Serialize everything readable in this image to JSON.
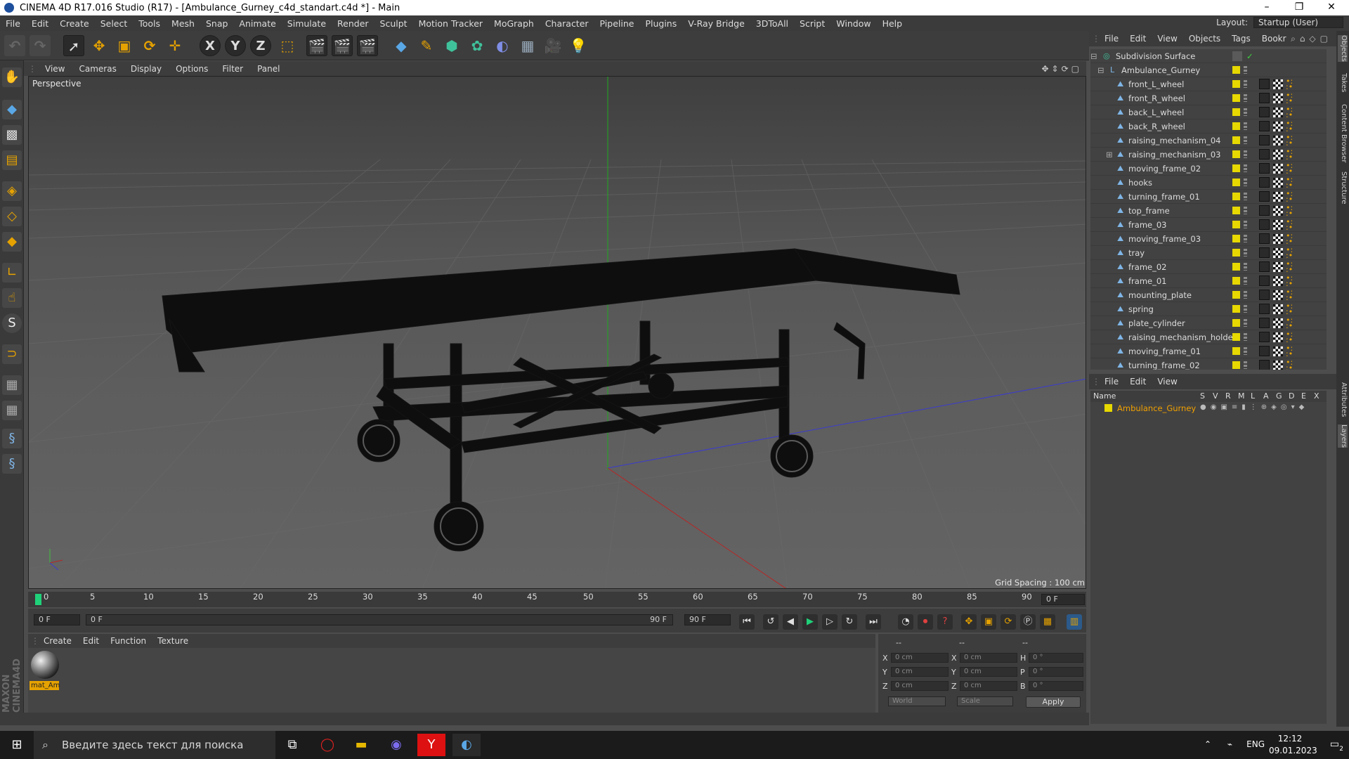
{
  "titlebar": {
    "title": "CINEMA 4D R17.016 Studio (R17) - [Ambulance_Gurney_c4d_standart.c4d *] - Main",
    "minimize": "–",
    "restore": "❐",
    "close": "✕"
  },
  "menu": [
    "File",
    "Edit",
    "Create",
    "Select",
    "Tools",
    "Mesh",
    "Snap",
    "Animate",
    "Simulate",
    "Render",
    "Sculpt",
    "Motion Tracker",
    "MoGraph",
    "Character",
    "Pipeline",
    "Plugins",
    "V-Ray Bridge",
    "3DToAll",
    "Script",
    "Window",
    "Help"
  ],
  "layout": {
    "label": "Layout:",
    "value": "Startup (User)"
  },
  "viewport": {
    "menu": [
      "View",
      "Cameras",
      "Display",
      "Options",
      "Filter",
      "Panel"
    ],
    "label": "Perspective",
    "grid_spacing": "Grid Spacing : 100 cm"
  },
  "timeline": {
    "ticks": [
      "0",
      "5",
      "10",
      "15",
      "20",
      "25",
      "30",
      "35",
      "40",
      "45",
      "50",
      "55",
      "60",
      "65",
      "70",
      "75",
      "80",
      "85",
      "90"
    ],
    "current_frame_right": "0 F",
    "start": "0 F",
    "range_start": "0 F",
    "range_end": "90 F",
    "end": "90 F"
  },
  "material": {
    "menu": [
      "Create",
      "Edit",
      "Function",
      "Texture"
    ],
    "items": [
      {
        "name": "mat_Am"
      }
    ]
  },
  "coords": {
    "headers": [
      "--",
      "--",
      "--"
    ],
    "rows": [
      {
        "a": "X",
        "av": "0 cm",
        "b": "X",
        "bv": "0 cm",
        "c": "H",
        "cv": "0 °"
      },
      {
        "a": "Y",
        "av": "0 cm",
        "b": "Y",
        "bv": "0 cm",
        "c": "P",
        "cv": "0 °"
      },
      {
        "a": "Z",
        "av": "0 cm",
        "b": "Z",
        "bv": "0 cm",
        "c": "B",
        "cv": "0 °"
      }
    ],
    "mode1": "World",
    "mode2": "Scale",
    "apply": "Apply"
  },
  "objects": {
    "menu": [
      "File",
      "Edit",
      "View",
      "Objects",
      "Tags",
      "Bookr"
    ],
    "root": "Subdivision Surface",
    "group": "Ambulance_Gurney",
    "items": [
      "front_L_wheel",
      "front_R_wheel",
      "back_L_wheel",
      "back_R_wheel",
      "raising_mechanism_04",
      "raising_mechanism_03",
      "moving_frame_02",
      "hooks",
      "turning_frame_01",
      "top_frame",
      "frame_03",
      "moving_frame_03",
      "tray",
      "frame_02",
      "frame_01",
      "mounting_plate",
      "spring",
      "plate_cylinder",
      "raising_mechanism_holder",
      "moving_frame_01",
      "turning_frame_02"
    ]
  },
  "layers": {
    "menu": [
      "File",
      "Edit",
      "View"
    ],
    "columns": [
      "Name",
      "S",
      "V",
      "R",
      "M",
      "L",
      "A",
      "G",
      "D",
      "E",
      "X"
    ],
    "row": "Ambulance_Gurney"
  },
  "right_tabs": [
    "Objects",
    "Takes",
    "Content Browser",
    "Structure",
    "Attributes",
    "Layers"
  ],
  "taskbar": {
    "search_placeholder": "Введите здесь текст для поиска",
    "lang": "ENG",
    "time": "12:12",
    "date": "09.01.2023",
    "notif": "2"
  },
  "colors": {
    "accent": "#e6a200",
    "layer_yellow": "#e6d800",
    "selection_text": "#f0a000"
  }
}
